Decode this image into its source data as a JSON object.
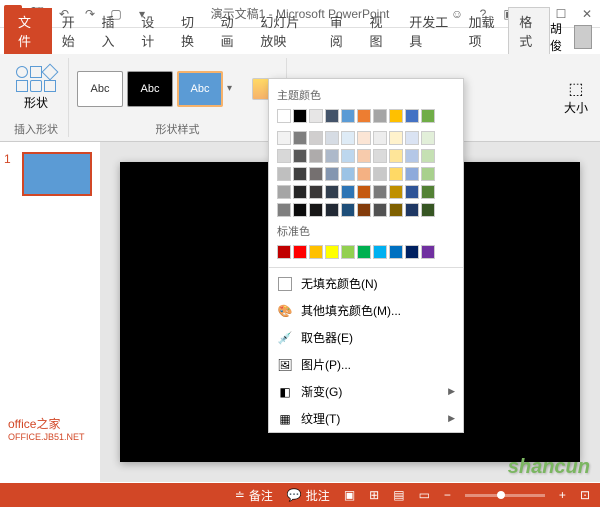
{
  "titlebar": {
    "title": "演示文稿1 - Microsoft PowerPoint"
  },
  "tabs": {
    "file": "文件",
    "items": [
      "开始",
      "插入",
      "设计",
      "切换",
      "动画",
      "幻灯片放映",
      "审阅",
      "视图",
      "开发工具",
      "加载项"
    ],
    "active": "格式",
    "user": "胡俊"
  },
  "ribbon": {
    "shapes_label": "形状",
    "insert_shape": "插入形状",
    "abc": "Abc",
    "shape_styles": "形状样式",
    "size": "大小"
  },
  "dropdown": {
    "theme_colors": "主题颜色",
    "standard_colors": "标准色",
    "no_fill": "无填充颜色(N)",
    "more_colors": "其他填充颜色(M)...",
    "eyedropper": "取色器(E)",
    "picture": "图片(P)...",
    "gradient": "渐变(G)",
    "texture": "纹理(T)",
    "theme_row1": [
      "#ffffff",
      "#000000",
      "#e7e6e6",
      "#44546a",
      "#5b9bd5",
      "#ed7d31",
      "#a5a5a5",
      "#ffc000",
      "#4472c4",
      "#70ad47"
    ],
    "theme_shades": [
      [
        "#f2f2f2",
        "#7f7f7f",
        "#d0cece",
        "#d6dce4",
        "#deebf6",
        "#fbe5d5",
        "#ededed",
        "#fff2cc",
        "#dae3f3",
        "#e2efd9"
      ],
      [
        "#d8d8d8",
        "#595959",
        "#aeabab",
        "#adb9ca",
        "#bdd7ee",
        "#f7cbac",
        "#dbdbdb",
        "#fee599",
        "#b4c7e7",
        "#c5e0b3"
      ],
      [
        "#bfbfbf",
        "#3f3f3f",
        "#757070",
        "#8496b0",
        "#9cc3e5",
        "#f4b183",
        "#c9c9c9",
        "#ffd965",
        "#8eaadb",
        "#a8d08d"
      ],
      [
        "#a5a5a5",
        "#262626",
        "#3a3838",
        "#323f4f",
        "#2e75b5",
        "#c55a11",
        "#7b7b7b",
        "#bf9000",
        "#2f5496",
        "#538135"
      ],
      [
        "#7f7f7f",
        "#0c0c0c",
        "#171616",
        "#222a35",
        "#1e4e79",
        "#833c0b",
        "#525252",
        "#7f6000",
        "#1f3864",
        "#375623"
      ]
    ],
    "standard_row": [
      "#c00000",
      "#ff0000",
      "#ffc000",
      "#ffff00",
      "#92d050",
      "#00b050",
      "#00b0f0",
      "#0070c0",
      "#002060",
      "#7030a0"
    ]
  },
  "thumb": {
    "num": "1"
  },
  "watermark": {
    "title": "office之家",
    "sub": "OFFICE.JB51.NET"
  },
  "watermark2": "shancun",
  "statusbar": {
    "notes": "备注",
    "comments": "批注"
  }
}
